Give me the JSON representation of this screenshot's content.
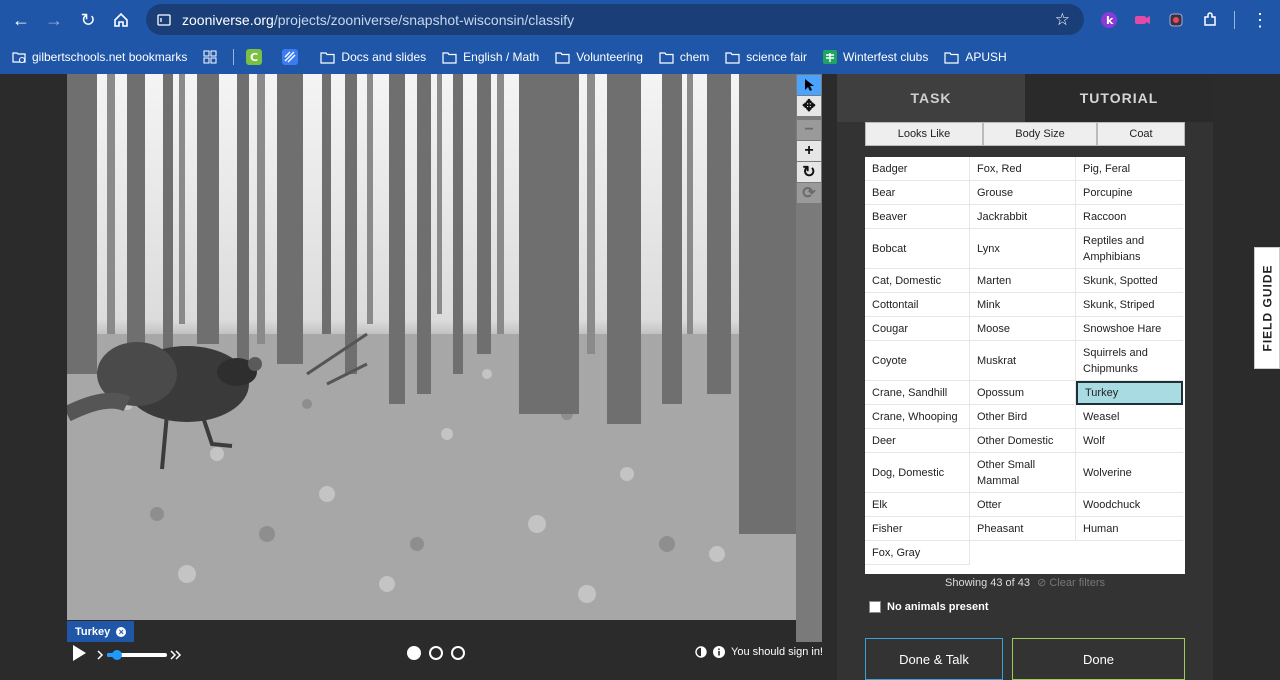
{
  "browser": {
    "url_host": "zooniverse.org",
    "url_path": "/projects/zooniverse/snapshot-wisconsin/classify",
    "bookmarks": [
      {
        "label": "gilbertschools.net bookmarks",
        "icon": "bookmarks-folder-icon"
      },
      {
        "label": "",
        "icon": "apps-grid-icon"
      },
      {
        "label": "",
        "icon": "classkick-icon"
      },
      {
        "label": "",
        "icon": "app-icon"
      },
      {
        "label": "Docs and slides",
        "icon": "folder-icon"
      },
      {
        "label": "English / Math",
        "icon": "folder-icon"
      },
      {
        "label": "Volunteering",
        "icon": "folder-icon"
      },
      {
        "label": "chem",
        "icon": "folder-icon"
      },
      {
        "label": "science fair",
        "icon": "folder-icon"
      },
      {
        "label": "Winterfest clubs",
        "icon": "sheets-icon"
      },
      {
        "label": "APUSH",
        "icon": "folder-icon"
      }
    ]
  },
  "viewer": {
    "subject_tag": "Turkey",
    "sign_in": "You should sign in!"
  },
  "panel": {
    "tabs": [
      "TASK",
      "TUTORIAL"
    ],
    "filters": [
      "Looks Like",
      "Body Size",
      "Coat"
    ],
    "choices": [
      "Badger",
      "Fox, Red",
      "Pig, Feral",
      "Bear",
      "Grouse",
      "Porcupine",
      "Beaver",
      "Jackrabbit",
      "Raccoon",
      "Bobcat",
      "Lynx",
      "Reptiles and Amphibians",
      "Cat, Domestic",
      "Marten",
      "Skunk, Spotted",
      "Cottontail",
      "Mink",
      "Skunk, Striped",
      "Cougar",
      "Moose",
      "Snowshoe Hare",
      "Coyote",
      "Muskrat",
      "Squirrels and Chipmunks",
      "Crane, Sandhill",
      "Opossum",
      "Turkey",
      "Crane, Whooping",
      "Other Bird",
      "Weasel",
      "Deer",
      "Other Domestic",
      "Wolf",
      "Dog, Domestic",
      "Other Small Mammal",
      "Wolverine",
      "Elk",
      "Otter",
      "Woodchuck",
      "Fisher",
      "Pheasant",
      "Human",
      "Fox, Gray"
    ],
    "selected_choice": "Turkey",
    "showing": "Showing 43 of 43",
    "clear_filters": "Clear filters",
    "no_animals": "No animals present",
    "done_talk": "Done & Talk",
    "done": "Done"
  },
  "field_guide": "FIELD GUIDE"
}
